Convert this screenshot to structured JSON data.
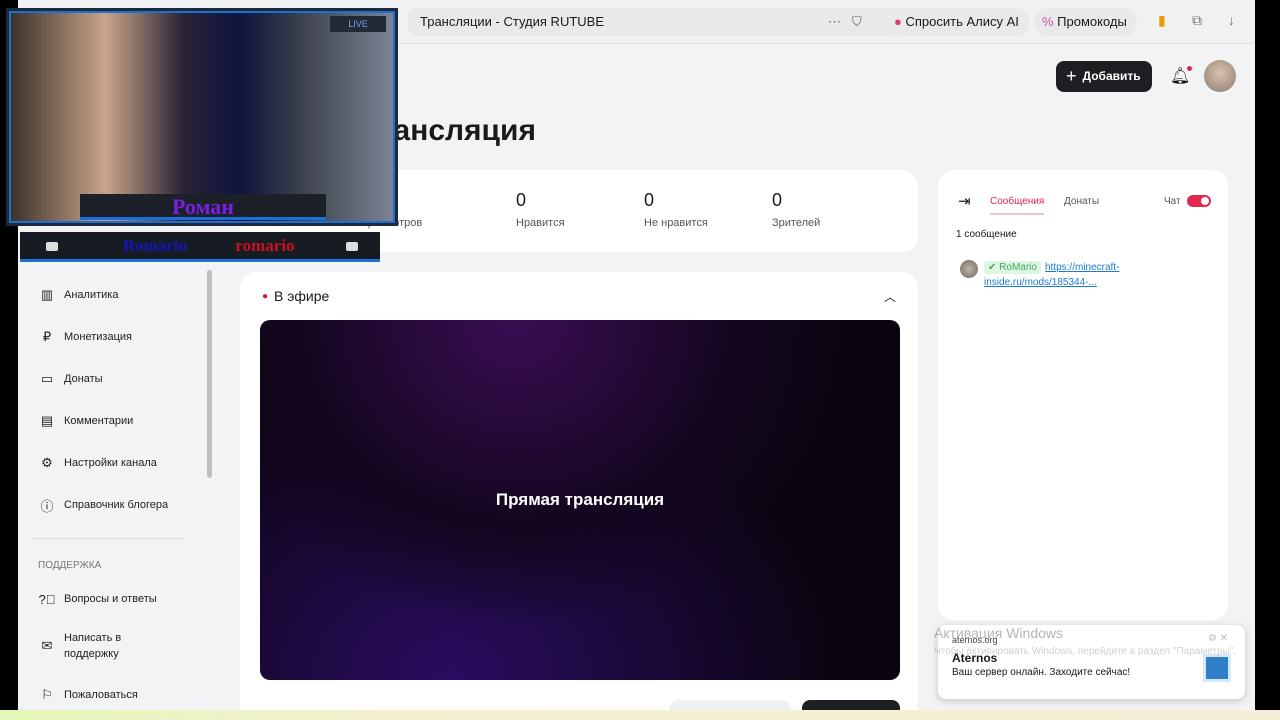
{
  "browser": {
    "tab_title": "Трансляции - Студия RUTUBE",
    "alice": "Спросить Алису AI",
    "promo": "Промокоды"
  },
  "header": {
    "add_label": "Добавить"
  },
  "page": {
    "title": "Трансляция"
  },
  "stats": [
    {
      "value": "0",
      "label": "Просмотров"
    },
    {
      "value": "0",
      "label": "Нравится"
    },
    {
      "value": "0",
      "label": "Не нравится"
    },
    {
      "value": "0",
      "label": "Зрителей"
    }
  ],
  "sidebar": {
    "items": [
      {
        "label": "Аналитика"
      },
      {
        "label": "Монетизация"
      },
      {
        "label": "Донаты"
      },
      {
        "label": "Комментарии"
      },
      {
        "label": "Настройки канала"
      },
      {
        "label": "Справочник блогера"
      }
    ],
    "support_heading": "ПОДДЕРЖКА",
    "support_items": [
      {
        "label": "Вопросы и ответы"
      },
      {
        "label": "Написать в поддержку"
      },
      {
        "label": "Пожаловаться"
      }
    ]
  },
  "live": {
    "title": "В эфире",
    "video_label": "Прямая трансляция"
  },
  "chat": {
    "tabs": [
      "Сообщения",
      "Донаты"
    ],
    "chat_label": "Чат",
    "chat_enabled": true,
    "count": "1 сообщение",
    "messages": [
      {
        "user": "RoMario",
        "text": "https://minecraft-inside.ru/mods/185344-..."
      }
    ]
  },
  "notification": {
    "source": "aternos.org",
    "title": "Aternos",
    "text": "Ваш сервер онлайн. Заходите сейчас!"
  },
  "watermark": {
    "title": "Активация Windows",
    "text": "Чтобы активировать Windows, перейдите в раздел \"Параметры\"."
  },
  "overlay": {
    "live": "LIVE",
    "name": "Роман",
    "left": "Romario",
    "right": "romario"
  },
  "colors": {
    "accent": "#e0284c",
    "dark_button": "#1e1f22"
  }
}
